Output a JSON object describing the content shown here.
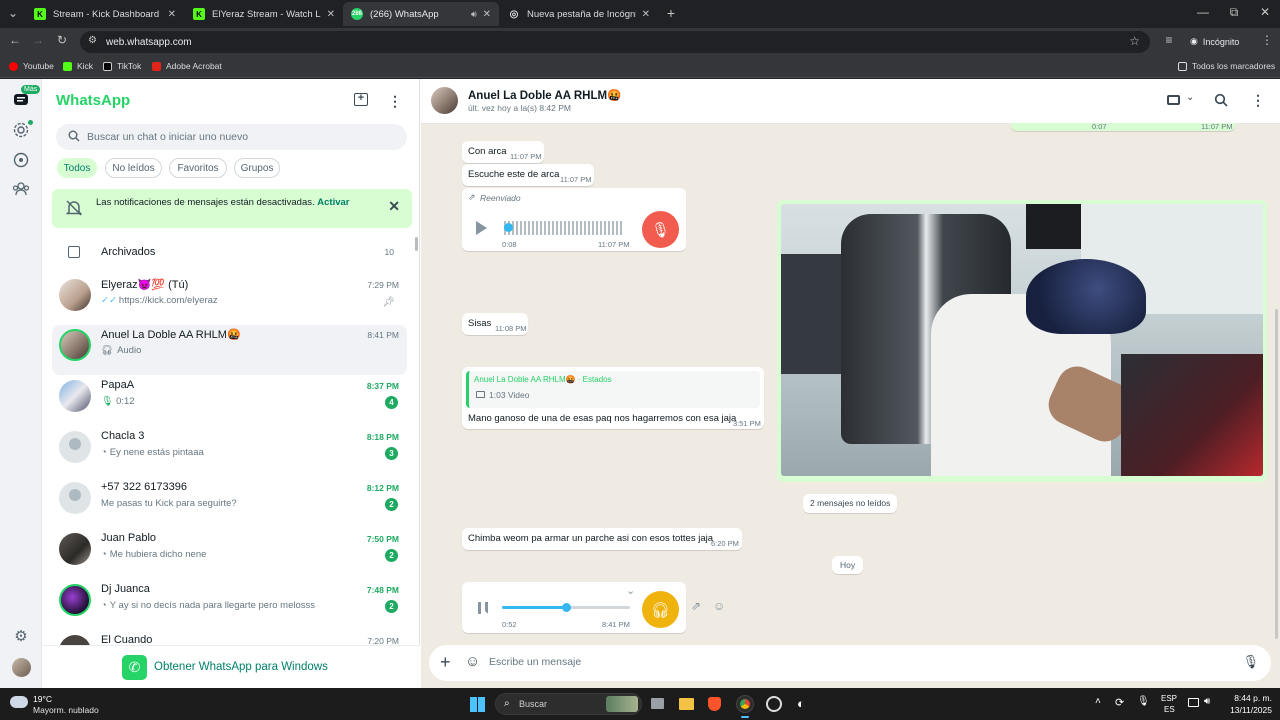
{
  "browser": {
    "tabs": [
      {
        "title": "Stream - Kick Dashboard",
        "favicon": "kick-icon",
        "active": false
      },
      {
        "title": "ElYeraz Stream - Watch Live on Kick",
        "favicon": "kick-icon",
        "active": false
      },
      {
        "title": "(266) WhatsApp",
        "favicon": "whatsapp-icon",
        "active": true
      },
      {
        "title": "Nueva pestaña de Incógnito",
        "favicon": "incognito-icon",
        "active": false
      }
    ],
    "url": "web.whatsapp.com",
    "incognito_label": "Incógnito",
    "bookmarks": [
      "Youtube",
      "Kick",
      "TikTok",
      "Adobe Acrobat"
    ],
    "all_bookmarks_label": "Todos los marcadores"
  },
  "rail": {
    "more_badge": "Más"
  },
  "sidebar": {
    "title": "WhatsApp",
    "search_placeholder": "Buscar un chat o iniciar uno nuevo",
    "filters": [
      "Todos",
      "No leídos",
      "Favoritos",
      "Grupos"
    ],
    "notification": {
      "text": "Las notificaciones de mensajes están desactivadas.",
      "action": "Activar"
    },
    "archived": {
      "label": "Archivados",
      "count": "10"
    },
    "chats": [
      {
        "name": "Elyeraz😈💯 (Tú)",
        "preview": "https://kick.com/elyeraz",
        "time": "7:29 PM",
        "unread": "",
        "preview_icon": "double-check-icon",
        "pinned": true
      },
      {
        "name": "Anuel La Doble AA RHLM🤬",
        "preview": "Audio",
        "time": "8:41 PM",
        "unread": "",
        "preview_icon": "headphones-icon",
        "selected": true
      },
      {
        "name": "PapaA",
        "preview": "0:12",
        "time": "8:37 PM",
        "unread": "4",
        "preview_icon": "mic-icon"
      },
      {
        "name": "Chacla 3",
        "preview": "Ey nene estás pintaaa",
        "time": "8:18 PM",
        "unread": "3",
        "preview_icon": "timer-icon"
      },
      {
        "name": "+57 322 6173396",
        "preview": "Me pasas tu Kick para seguirte?",
        "time": "8:12 PM",
        "unread": "2",
        "preview_icon": ""
      },
      {
        "name": "Juan Pablo",
        "preview": "Me hubiera dicho nene",
        "time": "7:50 PM",
        "unread": "2",
        "preview_icon": "timer-icon"
      },
      {
        "name": "Dj Juanca",
        "preview": "Y ay si no decís nada para llegarte pero melosss",
        "time": "7:48 PM",
        "unread": "2",
        "preview_icon": "timer-icon"
      },
      {
        "name": "El Cuando",
        "preview": "",
        "time": "7:20 PM",
        "unread": "",
        "preview_icon": ""
      }
    ],
    "get_windows": "Obtener WhatsApp para Windows"
  },
  "conversation": {
    "contact_name": "Anuel La Doble AA RHLM🤬",
    "last_seen": "últ. vez hoy a la(s) 8:42 PM",
    "messages": {
      "m0": {
        "duration": "0:07",
        "time": "11:07 PM"
      },
      "m1": {
        "text": "Con arca",
        "time": "11:07 PM"
      },
      "m2": {
        "text": "Escuche este de arca",
        "time": "11:07 PM"
      },
      "m3": {
        "forwarded": "Reenviado",
        "duration": "0:08",
        "time": "11:07 PM"
      },
      "m4": {
        "text": "Sisas",
        "time": "11:08 PM"
      },
      "m5": {
        "quote_author": "Anuel La Doble AA RHLM🤬 · Estados",
        "quote_media": "1:03 Video",
        "text": "Mano ganoso de una de esas paq nos hagarremos con esa jaja",
        "time": "3:51 PM"
      },
      "m6": {
        "text": "Chimba weom pa armar un parche asi con esos tottes jaja",
        "time": "6:20 PM"
      },
      "m7": {
        "duration": "0:52",
        "time": "8:41 PM",
        "progress": 0.5
      }
    },
    "unread_divider": "2 mensajes no leídos",
    "date_divider": "Hoy",
    "composer_placeholder": "Escribe un mensaje"
  },
  "taskbar": {
    "weather_temp": "19°C",
    "weather_desc": "Mayorm. nublado",
    "search": "Buscar",
    "lang_top": "ESP",
    "lang_bottom": "ES",
    "time": "8:44 p. m.",
    "date": "13/11/2025"
  },
  "colors": {
    "brand": "#25d366",
    "accent": "#008069",
    "mic_button": "#f15c4e",
    "audio_button": "#f0b30e"
  }
}
